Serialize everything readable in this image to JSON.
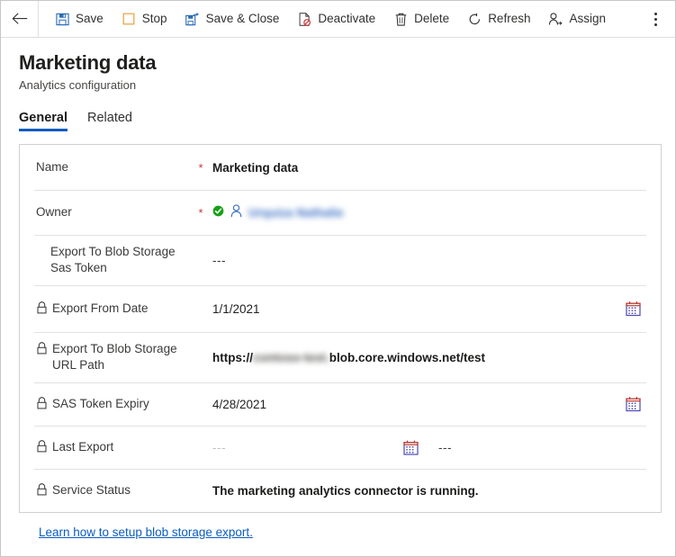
{
  "commandbar": {
    "back_icon": "back-arrow-icon",
    "overflow_icon": "more-commands-icon",
    "items": [
      {
        "label": "Save",
        "icon": "save-icon"
      },
      {
        "label": "Stop",
        "icon": "stop-icon"
      },
      {
        "label": "Save & Close",
        "icon": "save-and-close-icon"
      },
      {
        "label": "Deactivate",
        "icon": "deactivate-icon"
      },
      {
        "label": "Delete",
        "icon": "delete-icon"
      },
      {
        "label": "Refresh",
        "icon": "refresh-icon"
      },
      {
        "label": "Assign",
        "icon": "assign-icon"
      }
    ]
  },
  "header": {
    "title": "Marketing data",
    "subtitle": "Analytics configuration"
  },
  "tabs": [
    {
      "label": "General",
      "active": true
    },
    {
      "label": "Related",
      "active": false
    }
  ],
  "form": {
    "rows": [
      {
        "label": "Name",
        "required": "*",
        "locked": false,
        "value": "Marketing data"
      },
      {
        "label": "Owner",
        "required": "*",
        "locked": false,
        "value": "Urquiza Nathalie",
        "status_icon": "verified-check-icon",
        "person_icon": "person-icon"
      },
      {
        "label": "Export To Blob Storage Sas Token",
        "required": "",
        "locked": false,
        "value": "---"
      },
      {
        "label": "Export From Date",
        "required": "",
        "locked": true,
        "value": "1/1/2021",
        "calendar_icon": "calendar-icon"
      },
      {
        "label": "Export To Blob Storage URL Path",
        "required": "",
        "locked": true,
        "value_prefix": "https://",
        "value_host": "contoso-test.",
        "value_suffix": "blob.core.windows.net/test"
      },
      {
        "label": "SAS Token Expiry",
        "required": "",
        "locked": true,
        "value": "4/28/2021",
        "calendar_icon": "calendar-icon"
      },
      {
        "label": "Last Export",
        "required": "",
        "locked": true,
        "value": "---",
        "value_time": "---",
        "calendar_icon": "calendar-icon"
      },
      {
        "label": "Service Status",
        "required": "",
        "locked": true,
        "value": "The marketing analytics connector is running."
      }
    ]
  },
  "footer": {
    "link_label": "Learn how to setup blob storage export."
  },
  "colors": {
    "accent": "#0b5cc0",
    "required": "#d13438",
    "success": "#107c10",
    "stop_icon": "#e8a33d",
    "divider": "#e4e2e0"
  }
}
